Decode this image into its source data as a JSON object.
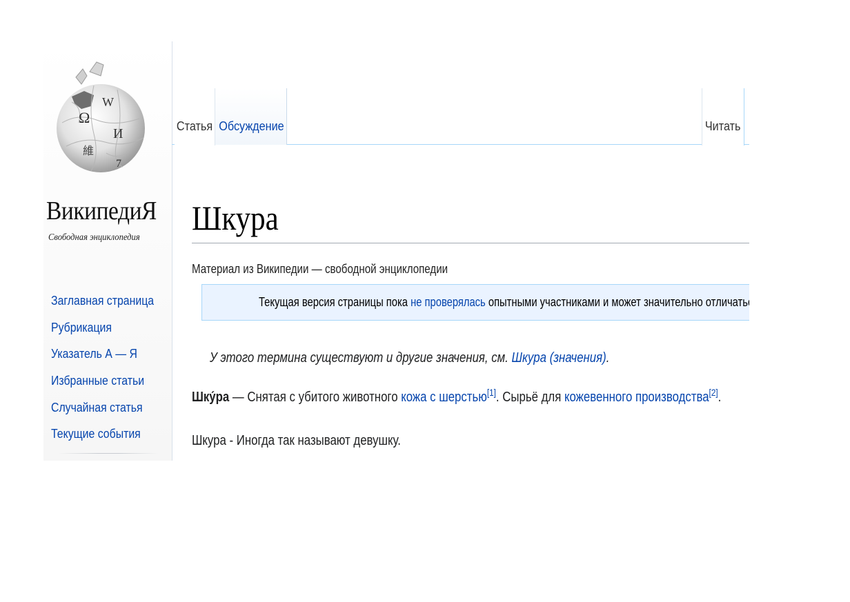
{
  "logo": {
    "wordmark": "ВикипедиЯ",
    "tagline": "Свободная энциклопедия",
    "globe_glyphs": [
      "Ω",
      "W",
      "И",
      "維",
      "7"
    ]
  },
  "sidebar": {
    "items": [
      {
        "label": "Заглавная страница"
      },
      {
        "label": "Рубрикация"
      },
      {
        "label": "Указатель А — Я"
      },
      {
        "label": "Избранные статьи"
      },
      {
        "label": "Случайная статья"
      },
      {
        "label": "Текущие события"
      }
    ]
  },
  "tabs": {
    "article": "Статья",
    "talk": "Обсуждение",
    "read": "Читать"
  },
  "page": {
    "title": "Шкура",
    "site_sub": "Материал из Википедии — свободной энциклопедии",
    "notice": {
      "before": "Текущая версия страницы пока ",
      "link": "не проверялась",
      "after": " опытными участниками и может значительно отличаться"
    },
    "hatnote": {
      "text": "У этого термина существуют и другие значения, см. ",
      "link": "Шкура (значения)",
      "end": "."
    },
    "para1": {
      "term": "Шку́ра",
      "text1": " — Снятая с убитого животного ",
      "link1": "кожа",
      "space": " ",
      "link2": "с шерстью",
      "ref1": "[1]",
      "text2": ". Сырьё для ",
      "link3": "кожевенного производства",
      "ref2": "[2]",
      "end": "."
    },
    "para2": "Шкура - Иногда так называют девушку."
  },
  "colors": {
    "link": "#0645ad",
    "notice_bg": "#eaf3ff",
    "notice_border": "#a7d7f9",
    "title_rule": "#a2a9b1"
  }
}
